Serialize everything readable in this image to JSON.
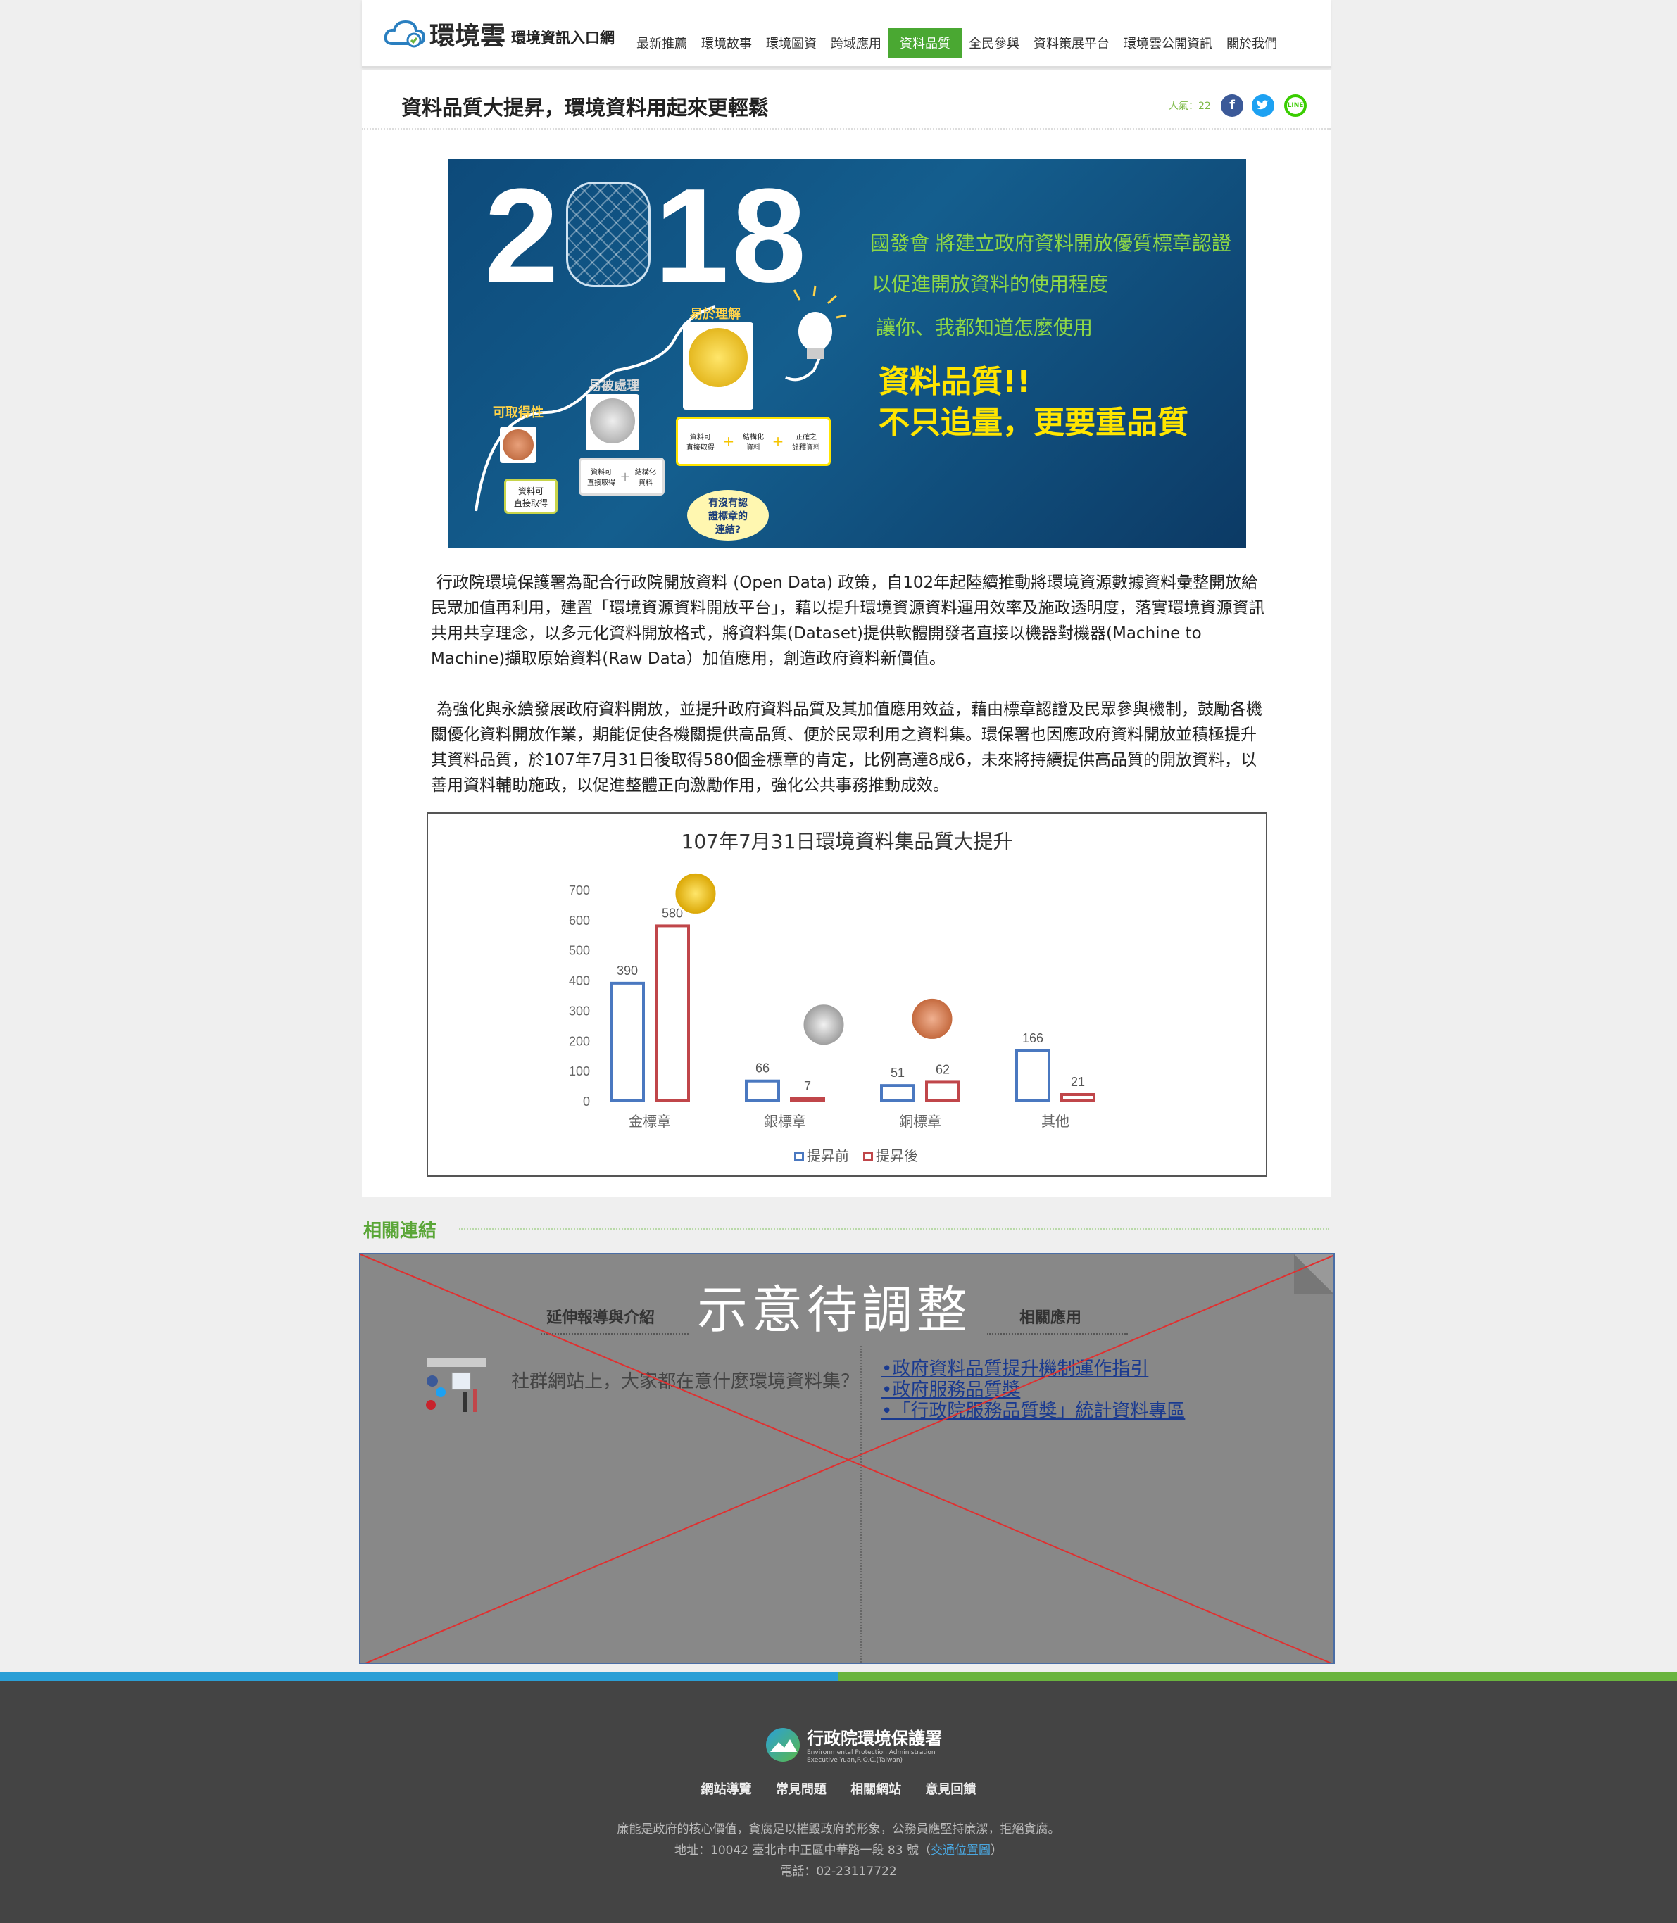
{
  "header": {
    "logo_text": "環境雲",
    "logo_sub": "環境資訊入口網",
    "nav": [
      "最新推薦",
      "環境故事",
      "環境圖資",
      "跨域應用",
      "資料品質",
      "全民參與",
      "資料策展平台",
      "環境雲公開資訊",
      "關於我們"
    ],
    "active_nav": "資料品質"
  },
  "article": {
    "title": "資料品質大提昇，環境資料用起來更輕鬆",
    "views": "人氣：22",
    "share_line": "LINE",
    "paragraphs": [
      "行政院環境保護署為配合行政院開放資料 (Open Data) 政策，自102年起陸續推動將環境資源數據資料彙整開放給民眾加值再利用，建置「環境資源資料開放平台」，藉以提升環境資源資料運用效率及施政透明度，落實環境資源資訊共用共享理念，以多元化資料開放格式，將資料集(Dataset)提供軟體開發者直接以機器對機器(Machine to Machine)擷取原始資料(Raw Data）加值應用，創造政府資料新價值。",
      "為強化與永續發展政府資料開放，並提升政府資料品質及其加值應用效益，藉由標章認證及民眾參與機制，鼓勵各機關優化資料開放作業，期能促使各機關提供高品質、便於民眾利用之資料集。環保署也因應政府資料開放並積極提升其資料品質，於107年7月31日後取得580個金標章的肯定，比例高達8成6，未來將持續提供高品質的開放資料，以善用資料輔助施政，以促進整體正向激勵作用，強化公共事務推動成效。"
    ]
  },
  "banner": {
    "year_left": "2",
    "year_right": "18",
    "line1": "國發會 將建立政府資料開放優質標章認證",
    "line2": "以促進開放資料的使用程度",
    "line3": "讓你、我都知道怎麼使用",
    "big1": "資料品質!!",
    "big2": "不只追量，更要重品質",
    "step1": "可取得性",
    "step2": "易被處理",
    "step3": "易於理解",
    "card1": "資料可\n直接取得",
    "card2a": "資料可\n直接取得",
    "card2b": "結構化\n資料",
    "card3a": "資料可\n直接取得",
    "card3b": "結構化\n資料",
    "card3c": "正確之\n詮釋資料",
    "medal1": "銅標章",
    "medal2": "銀標章",
    "medal3": "金標章",
    "bubble": "有沒有認\n證標章的\n連結?",
    "plus": "+"
  },
  "chart_data": {
    "type": "bar",
    "title": "107年7月31日環境資料集品質大提升",
    "categories": [
      "金標章",
      "銀標章",
      "銅標章",
      "其他"
    ],
    "series": [
      {
        "name": "提昇前",
        "values": [
          390,
          66,
          51,
          166
        ],
        "color": "#4a78c0"
      },
      {
        "name": "提昇後",
        "values": [
          580,
          7,
          62,
          21
        ],
        "color": "#c0464a"
      }
    ],
    "ylim": [
      0,
      700
    ],
    "yticks": [
      0,
      100,
      200,
      300,
      400,
      500,
      600,
      700
    ],
    "grid": false,
    "legend": "bottom"
  },
  "related": {
    "heading": "相關連結",
    "placeholder": "示意待調整",
    "col_left_title": "延伸報導與介紹",
    "col_right_title": "相關應用",
    "ext_item": "社群網站上，大家都在意什麼環境資料集？",
    "links": [
      "•政府資料品質提升機制運作指引",
      "•政府服務品質獎",
      "•「行政院服務品質獎」統計資料專區"
    ]
  },
  "footer": {
    "org_zh": "行政院環境保護署",
    "org_en1": "Environmental Protection Administration",
    "org_en2": "Executive Yuan,R.O.C.(Taiwan)",
    "links": [
      "網站導覽",
      "常見問題",
      "相關網站",
      "意見回饋"
    ],
    "motto": "廉能是政府的核心價值，貪腐足以摧毀政府的形象，公務員應堅持廉潔，拒絕貪腐。",
    "address_prefix": "地址：10042 臺北市中正區中華路一段 83 號（",
    "address_link": "交通位置圖",
    "address_suffix": "）",
    "phone": "電話：02-23117722"
  }
}
